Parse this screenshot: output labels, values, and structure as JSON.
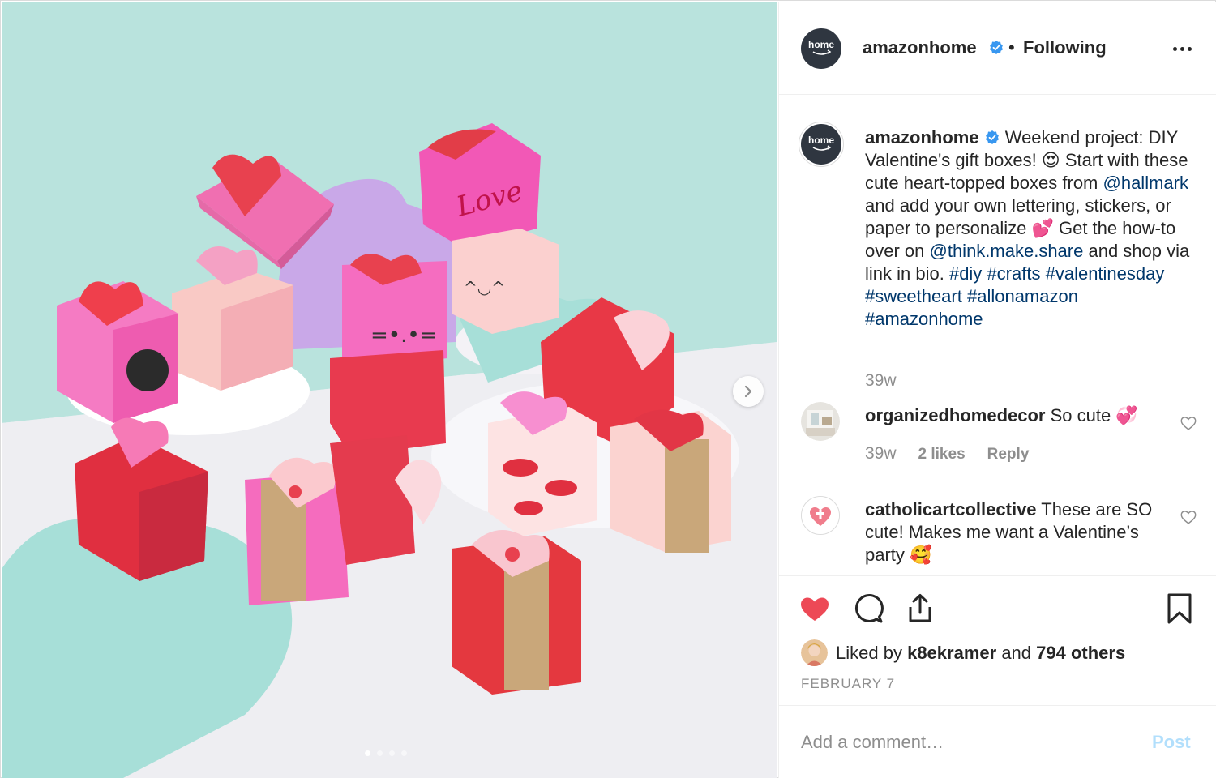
{
  "post": {
    "username": "amazonhome",
    "verified": true,
    "separator": "•",
    "follow_state": "Following",
    "avatar_text": "home",
    "carousel": {
      "slide_count": 4,
      "active_slide": 1
    }
  },
  "caption": {
    "username": "amazonhome",
    "parts": [
      {
        "t": " Weekend project: DIY Valentine's gift boxes! 😍  Start with these cute heart-topped boxes from ",
        "link": false
      },
      {
        "t": "@hallmark",
        "link": true
      },
      {
        "t": " and add your own lettering, stickers, or paper to personalize 💕 Get the how-to over on ",
        "link": false
      },
      {
        "t": "@think.make.share",
        "link": true
      },
      {
        "t": " and shop via link in bio. ",
        "link": false
      },
      {
        "t": "#diy",
        "link": true
      },
      {
        "t": " ",
        "link": false
      },
      {
        "t": "#crafts",
        "link": true
      },
      {
        "t": " ",
        "link": false
      },
      {
        "t": "#valentinesday",
        "link": true
      },
      {
        "t": " ",
        "link": false
      },
      {
        "t": "#sweetheart",
        "link": true
      },
      {
        "t": " ",
        "link": false
      },
      {
        "t": "#allonamazon",
        "link": true
      },
      {
        "t": " ",
        "link": false
      },
      {
        "t": "#amazonhome",
        "link": true
      }
    ],
    "time": "39w"
  },
  "comments": [
    {
      "username": "organizedhomedecor",
      "text": " So cute 💞",
      "time": "39w",
      "likes": "2 likes",
      "reply": "Reply"
    },
    {
      "username": "catholicartcollective",
      "text": " These are SO cute! Makes me want a Valentine’s party 🥰"
    }
  ],
  "actions": {
    "liked_prefix": "Liked by",
    "liked_user": "k8ekramer",
    "liked_and": "and",
    "liked_others": "794 others",
    "date": "FEBRUARY 7",
    "heart_color": "#ed4956"
  },
  "composer": {
    "placeholder": "Add a comment…",
    "post_label": "Post"
  }
}
